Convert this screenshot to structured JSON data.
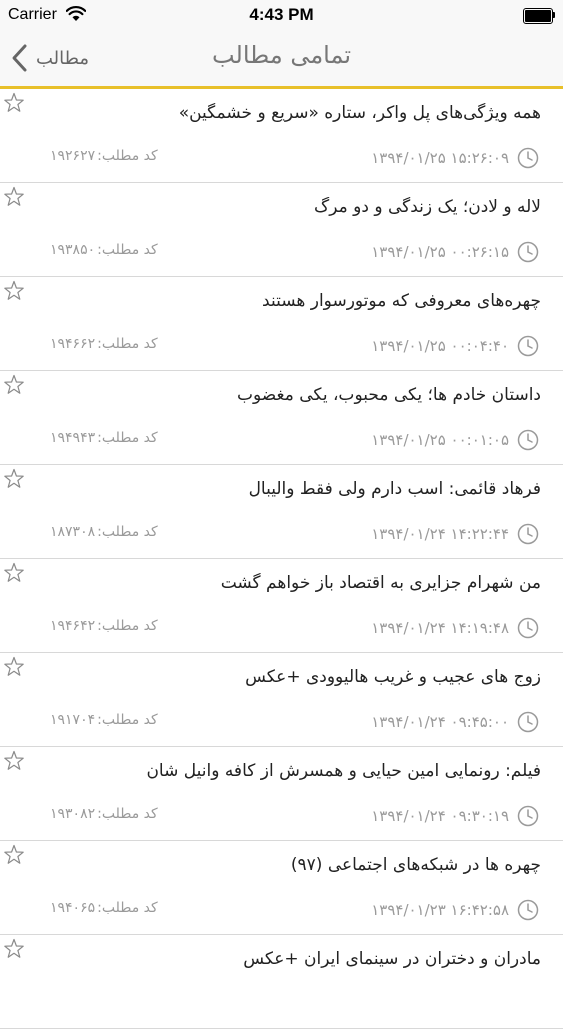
{
  "status_bar": {
    "carrier": "Carrier",
    "time": "4:43 PM"
  },
  "nav": {
    "back_label": "مطالب",
    "title": "تمامی مطالب"
  },
  "code_label": "کد مطلب:",
  "colors": {
    "accent": "#e8c02a",
    "meta_text": "#9a9a9a",
    "title_text": "#222222",
    "nav_title": "#777777"
  },
  "icons": {
    "back": "chevron-left-icon",
    "favorite": "star-outline-icon",
    "time": "clock-icon"
  },
  "articles": [
    {
      "title": "همه ویژگی‌های پل واکر، ستاره «سریع و خشمگین»",
      "datetime": "۱۳۹۴/۰۱/۲۵ ۱۵:۲۶:۰۹",
      "code": "۱۹۲۶۲۷"
    },
    {
      "title": "لاله و لادن؛ یک زندگی و دو مرگ",
      "datetime": "۱۳۹۴/۰۱/۲۵ ۰۰:۲۶:۱۵",
      "code": "۱۹۳۸۵۰"
    },
    {
      "title": "چهره‌های معروفی که موتورسوار هستند",
      "datetime": "۱۳۹۴/۰۱/۲۵ ۰۰:۰۴:۴۰",
      "code": "۱۹۴۶۶۲"
    },
    {
      "title": "داستان خادم ها؛ یکی محبوب، یکی مغضوب",
      "datetime": "۱۳۹۴/۰۱/۲۵ ۰۰:۰۱:۰۵",
      "code": "۱۹۴۹۴۳"
    },
    {
      "title": "فرهاد قائمی: اسب دارم ولی فقط والیبال",
      "datetime": "۱۳۹۴/۰۱/۲۴ ۱۴:۲۲:۴۴",
      "code": "۱۸۷۳۰۸"
    },
    {
      "title": "من شهرام جزایری به اقتصاد باز خواهم گشت",
      "datetime": "۱۳۹۴/۰۱/۲۴ ۱۴:۱۹:۴۸",
      "code": "۱۹۴۶۴۲"
    },
    {
      "title": "زوج های عجیب و غریب هالیوودی +عکس",
      "datetime": "۱۳۹۴/۰۱/۲۴ ۰۹:۴۵:۰۰",
      "code": "۱۹۱۷۰۴"
    },
    {
      "title": "فیلم: رونمایی امین حیایی و همسرش از کافه وانیل شان",
      "datetime": "۱۳۹۴/۰۱/۲۴ ۰۹:۳۰:۱۹",
      "code": "۱۹۳۰۸۲"
    },
    {
      "title": "چهره ها در شبکه‌های اجتماعی (۹۷)",
      "datetime": "۱۳۹۴/۰۱/۲۳ ۱۶:۴۲:۵۸",
      "code": "۱۹۴۰۶۵"
    },
    {
      "title": "مادران و دختران در سینمای ایران +عکس",
      "datetime": "",
      "code": ""
    }
  ]
}
